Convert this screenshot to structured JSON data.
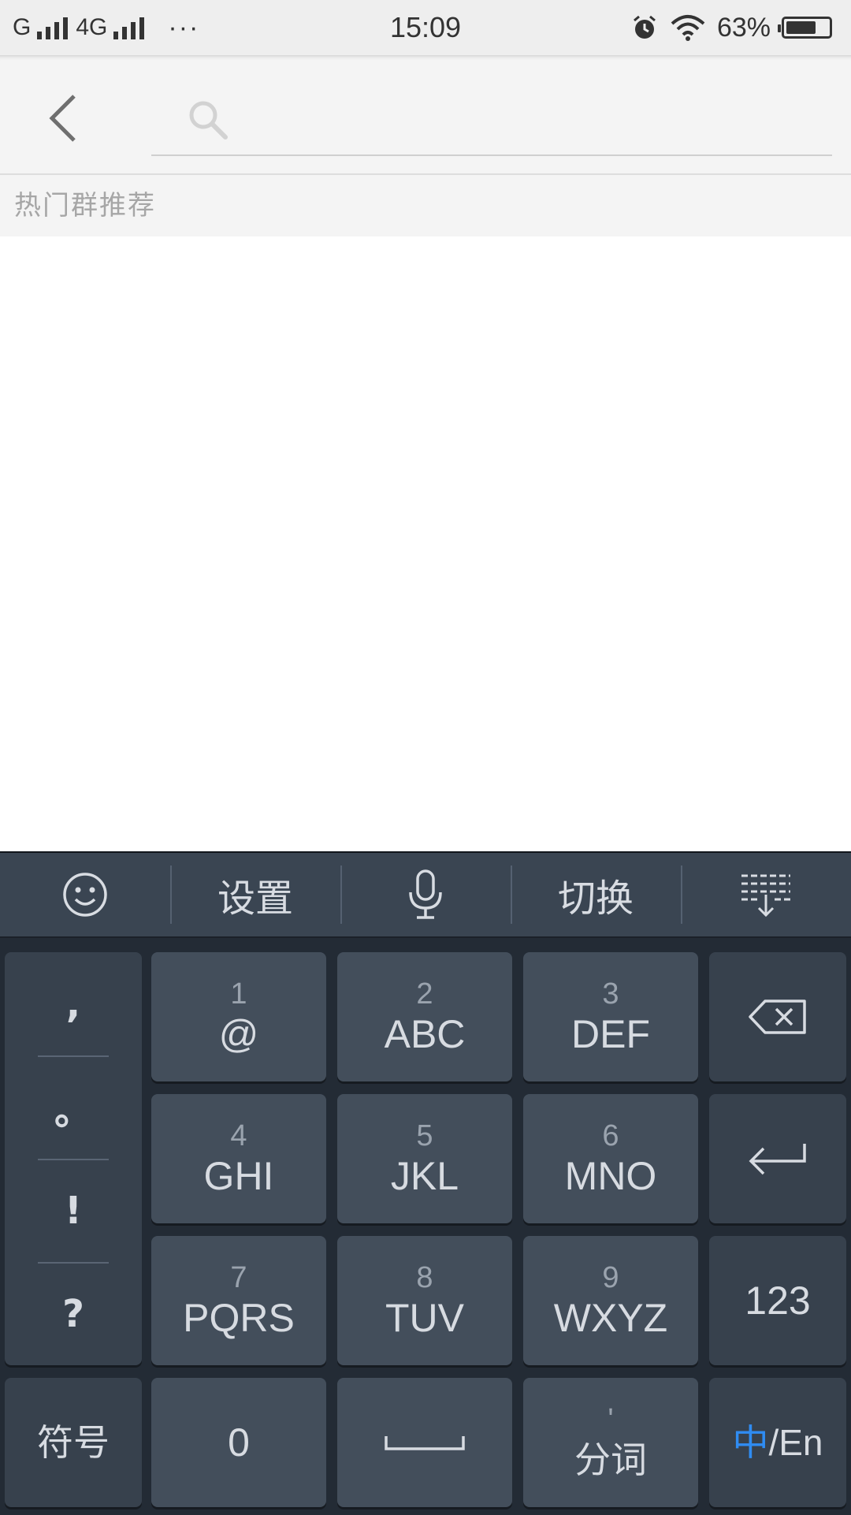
{
  "status_bar": {
    "carrier1": "G",
    "carrier2": "4G",
    "dots": "···",
    "time": "15:09",
    "battery": "63%"
  },
  "search": {
    "placeholder": "",
    "value": ""
  },
  "section": {
    "title": "热门群推荐"
  },
  "keyboard": {
    "toolbar": {
      "settings": "设置",
      "switch": "切换"
    },
    "symbols": [
      ",",
      "。",
      "!",
      "?"
    ],
    "keys": [
      {
        "num": "1",
        "letters": "@"
      },
      {
        "num": "2",
        "letters": "ABC"
      },
      {
        "num": "3",
        "letters": "DEF"
      },
      {
        "num": "4",
        "letters": "GHI"
      },
      {
        "num": "5",
        "letters": "JKL"
      },
      {
        "num": "6",
        "letters": "MNO"
      },
      {
        "num": "7",
        "letters": "PQRS"
      },
      {
        "num": "8",
        "letters": "TUV"
      },
      {
        "num": "9",
        "letters": "WXYZ"
      }
    ],
    "numbers_key": "123",
    "symbols_key": "符号",
    "zero_key": "0",
    "segment_key_mark": "'",
    "segment_key": "分词",
    "lang_key_cn": "中",
    "lang_key_en": "/En"
  },
  "colors": {
    "accent": "#2f8cf2",
    "keyboard_bg": "#232b35",
    "key_bg": "#434e5b"
  }
}
